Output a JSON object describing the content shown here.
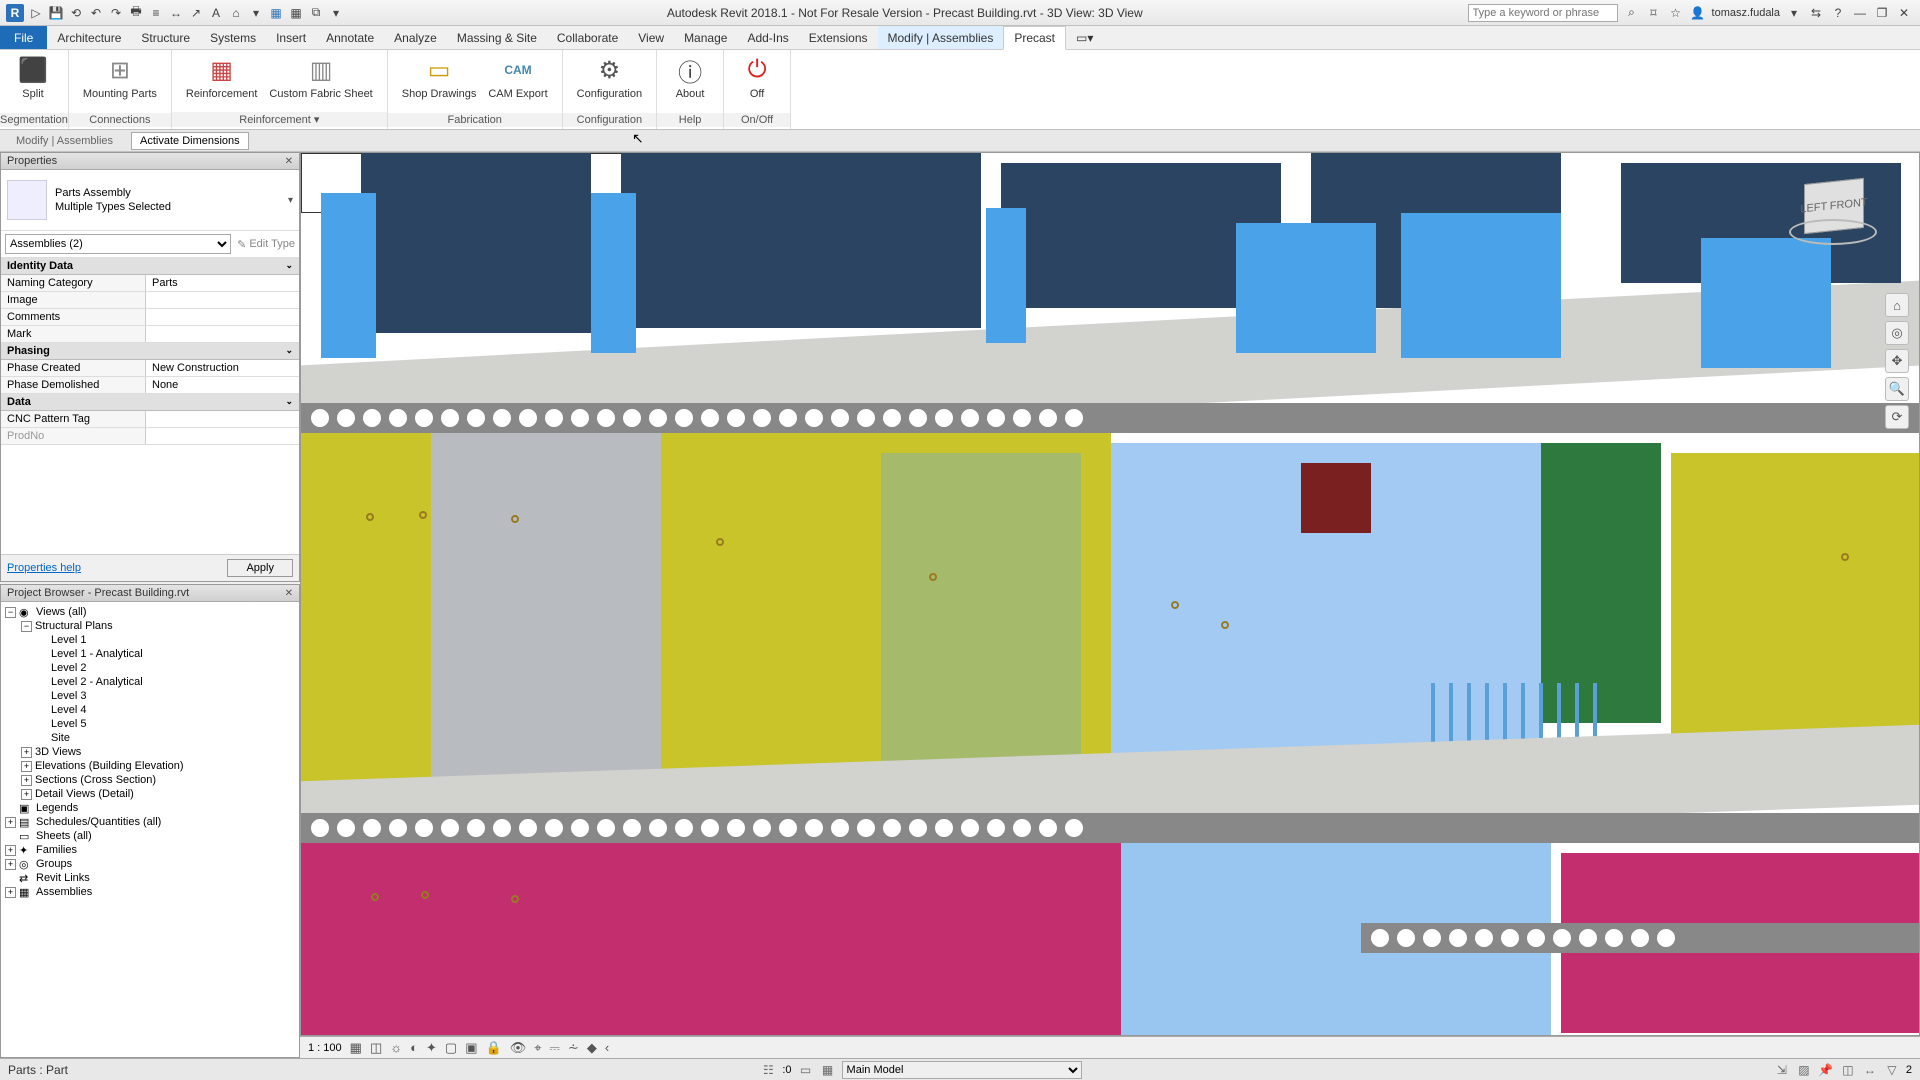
{
  "titlebar": {
    "title": "Autodesk Revit 2018.1 - Not For Resale Version -   Precast Building.rvt - 3D View: 3D View",
    "search_placeholder": "Type a keyword or phrase",
    "username": "tomasz.fudala"
  },
  "menubar": {
    "file": "File",
    "tabs": [
      "Architecture",
      "Structure",
      "Systems",
      "Insert",
      "Annotate",
      "Analyze",
      "Massing & Site",
      "Collaborate",
      "View",
      "Manage",
      "Add-Ins",
      "Extensions",
      "Modify | Assemblies",
      "Precast"
    ],
    "active": "Precast"
  },
  "ribbon": {
    "groups": [
      {
        "label": "Segmentation",
        "buttons": [
          {
            "label": "Split",
            "icon": "✂"
          }
        ]
      },
      {
        "label": "Connections",
        "buttons": [
          {
            "label": "Mounting Parts",
            "icon": "▦"
          }
        ]
      },
      {
        "label": "Reinforcement ▾",
        "buttons": [
          {
            "label": "Reinforcement",
            "icon": "▤"
          },
          {
            "label": "Custom Fabric Sheet",
            "icon": "▥"
          }
        ]
      },
      {
        "label": "Fabrication",
        "buttons": [
          {
            "label": "Shop Drawings",
            "icon": "▭"
          },
          {
            "label": "CAM Export",
            "icon": "CAM"
          }
        ]
      },
      {
        "label": "Configuration",
        "buttons": [
          {
            "label": "Configuration",
            "icon": "⚙"
          }
        ]
      },
      {
        "label": "Help",
        "buttons": [
          {
            "label": "About",
            "icon": "ℹ"
          }
        ]
      },
      {
        "label": "On/Off",
        "buttons": [
          {
            "label": "Off",
            "icon": "⏻"
          }
        ]
      }
    ]
  },
  "optionsbar": {
    "context": "Modify | Assemblies",
    "button": "Activate Dimensions"
  },
  "properties": {
    "title": "Properties",
    "type_name": "Parts Assembly",
    "type_sub": "Multiple Types Selected",
    "filter": "Assemblies (2)",
    "edit_type": "Edit Type",
    "sections": [
      {
        "name": "Identity Data",
        "rows": [
          {
            "k": "Naming Category",
            "v": "Parts"
          },
          {
            "k": "Image",
            "v": ""
          },
          {
            "k": "Comments",
            "v": ""
          },
          {
            "k": "Mark",
            "v": ""
          }
        ]
      },
      {
        "name": "Phasing",
        "rows": [
          {
            "k": "Phase Created",
            "v": "New Construction"
          },
          {
            "k": "Phase Demolished",
            "v": "None"
          }
        ]
      },
      {
        "name": "Data",
        "rows": [
          {
            "k": "CNC Pattern Tag",
            "v": ""
          },
          {
            "k": "ProdNo",
            "v": "",
            "disabled": true
          }
        ]
      }
    ],
    "help": "Properties help",
    "apply": "Apply"
  },
  "browser": {
    "title": "Project Browser - Precast Building.rvt",
    "tree": [
      {
        "lvl": 0,
        "exp": "−",
        "icon": "◉",
        "label": "Views (all)"
      },
      {
        "lvl": 1,
        "exp": "−",
        "icon": "",
        "label": "Structural Plans"
      },
      {
        "lvl": 2,
        "exp": "",
        "icon": "",
        "label": "Level 1"
      },
      {
        "lvl": 2,
        "exp": "",
        "icon": "",
        "label": "Level 1 - Analytical"
      },
      {
        "lvl": 2,
        "exp": "",
        "icon": "",
        "label": "Level 2"
      },
      {
        "lvl": 2,
        "exp": "",
        "icon": "",
        "label": "Level 2 - Analytical"
      },
      {
        "lvl": 2,
        "exp": "",
        "icon": "",
        "label": "Level 3"
      },
      {
        "lvl": 2,
        "exp": "",
        "icon": "",
        "label": "Level 4"
      },
      {
        "lvl": 2,
        "exp": "",
        "icon": "",
        "label": "Level 5"
      },
      {
        "lvl": 2,
        "exp": "",
        "icon": "",
        "label": "Site"
      },
      {
        "lvl": 1,
        "exp": "+",
        "icon": "",
        "label": "3D Views"
      },
      {
        "lvl": 1,
        "exp": "+",
        "icon": "",
        "label": "Elevations (Building Elevation)"
      },
      {
        "lvl": 1,
        "exp": "+",
        "icon": "",
        "label": "Sections (Cross Section)"
      },
      {
        "lvl": 1,
        "exp": "+",
        "icon": "",
        "label": "Detail Views (Detail)"
      },
      {
        "lvl": 0,
        "exp": "",
        "icon": "▣",
        "label": "Legends"
      },
      {
        "lvl": 0,
        "exp": "+",
        "icon": "▤",
        "label": "Schedules/Quantities (all)"
      },
      {
        "lvl": 0,
        "exp": "",
        "icon": "▭",
        "label": "Sheets (all)"
      },
      {
        "lvl": 0,
        "exp": "+",
        "icon": "✦",
        "label": "Families"
      },
      {
        "lvl": 0,
        "exp": "+",
        "icon": "◎",
        "label": "Groups"
      },
      {
        "lvl": 0,
        "exp": "",
        "icon": "⇄",
        "label": "Revit Links"
      },
      {
        "lvl": 0,
        "exp": "+",
        "icon": "▦",
        "label": "Assemblies"
      }
    ]
  },
  "viewctrl": {
    "scale": "1 : 100"
  },
  "status": {
    "left": "Parts : Part",
    "zero_count": ":0",
    "workset": "Main Model"
  },
  "viewcube": {
    "face1": "LEFT",
    "face2": "FRONT"
  }
}
